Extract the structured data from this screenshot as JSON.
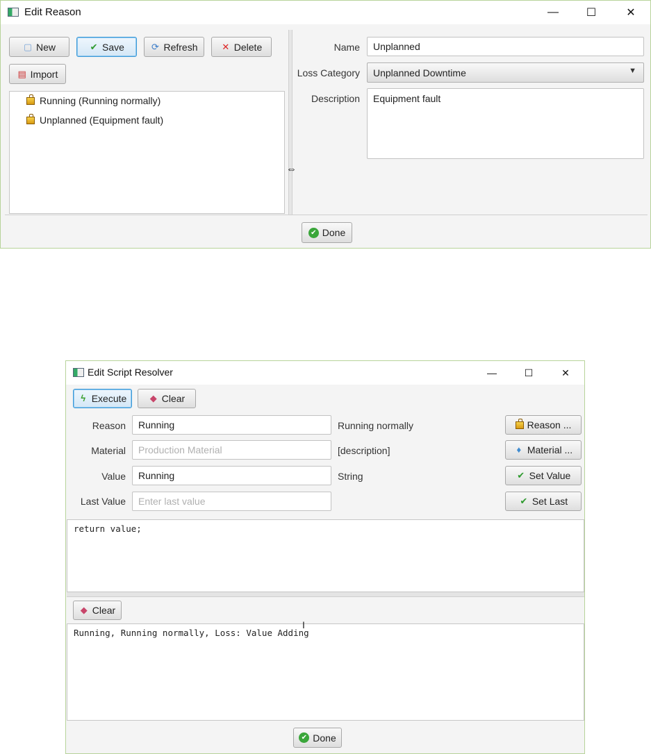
{
  "edit_reason": {
    "title": "Edit Reason",
    "window_controls": {
      "minimize": "—",
      "maximize": "☐",
      "close": "✕"
    },
    "toolbar": {
      "new": "New",
      "save": "Save",
      "refresh": "Refresh",
      "delete": "Delete",
      "import": "Import"
    },
    "tree": [
      {
        "label": "Running (Running normally)"
      },
      {
        "label": "Unplanned (Equipment fault)"
      }
    ],
    "form": {
      "name_label": "Name",
      "name_value": "Unplanned",
      "loss_label": "Loss Category",
      "loss_value": "Unplanned Downtime",
      "desc_label": "Description",
      "desc_value": "Equipment fault"
    },
    "done": "Done"
  },
  "edit_script": {
    "title": "Edit Script Resolver",
    "window_controls": {
      "minimize": "—",
      "maximize": "☐",
      "close": "✕"
    },
    "toolbar": {
      "execute": "Execute",
      "clear": "Clear"
    },
    "rows": {
      "reason_label": "Reason",
      "reason_value": "Running",
      "reason_info": "Running normally",
      "reason_btn": "Reason ...",
      "material_label": "Material",
      "material_placeholder": "Production Material",
      "material_info": "[description]",
      "material_btn": "Material ...",
      "value_label": "Value",
      "value_value": "Running",
      "value_info": "String",
      "value_btn": "Set Value",
      "last_label": "Last Value",
      "last_placeholder": "Enter last value",
      "last_btn": "Set Last"
    },
    "script": "return value;",
    "result_clear": "Clear",
    "result": "Running, Running normally, Loss: Value Adding",
    "done": "Done"
  }
}
